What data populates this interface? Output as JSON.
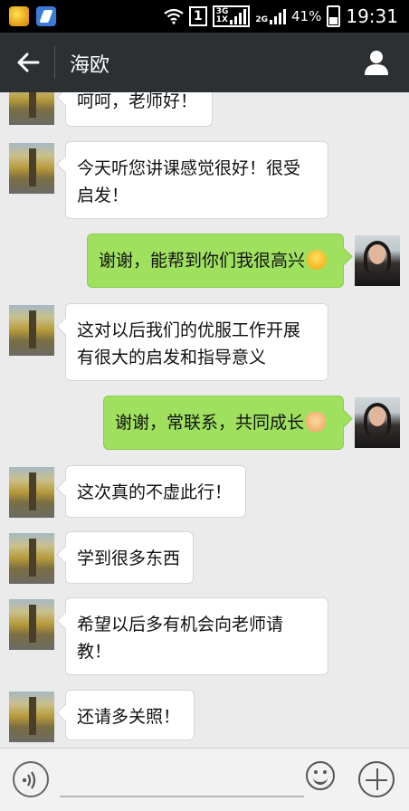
{
  "status_bar": {
    "sim_slot": "1",
    "network_top": "3G",
    "network_bottom": "1X",
    "network_2g": "2G",
    "battery_percent": "41%",
    "time": "19:31"
  },
  "header": {
    "title": "海欧",
    "back_icon": "arrow-left-icon",
    "contact_icon": "person-icon"
  },
  "messages": [
    {
      "side": "left",
      "text": "呵呵，老师好！"
    },
    {
      "side": "left",
      "text": "今天听您讲课感觉很好！很受启发！"
    },
    {
      "side": "right",
      "text": "谢谢，能帮到你们我很高兴",
      "emoji": "grin-emoji"
    },
    {
      "side": "left",
      "text": "这对以后我们的优服工作开展有很大的启发和指导意义"
    },
    {
      "side": "right",
      "text": "谢谢，常联系，共同成长",
      "emoji": "handshake-emoji"
    },
    {
      "side": "left",
      "text": "这次真的不虚此行！"
    },
    {
      "side": "left",
      "text": "学到很多东西"
    },
    {
      "side": "left",
      "text": "希望以后多有机会向老师请教！"
    },
    {
      "side": "left",
      "text": "还请多关照！"
    }
  ],
  "input_bar": {
    "voice_icon": "voice-icon",
    "emoji_icon": "smiley-icon",
    "more_icon": "plus-icon"
  }
}
